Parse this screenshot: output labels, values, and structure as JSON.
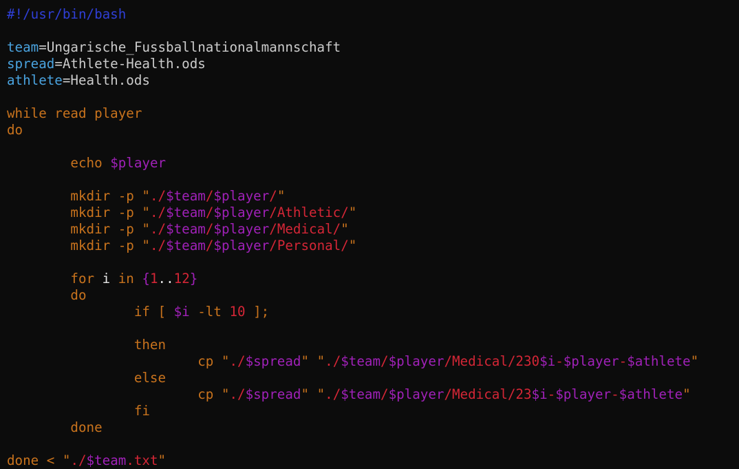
{
  "colors": {
    "background": "#0c0c0c",
    "shebang": "#2f3fd6",
    "variable_name": "#4aa3df",
    "plain_text": "#cccccc",
    "keyword": "#c9731d",
    "expansion": "#a021b8",
    "string_literal": "#d42636",
    "identifier": "#e6e6e6"
  },
  "editor": {
    "cursor": {
      "line": 24,
      "after_token": 12
    },
    "lines": [
      [
        {
          "t": "#!/usr/bin/bash",
          "c": "shebang"
        }
      ],
      [],
      [
        {
          "t": "team",
          "c": "var"
        },
        {
          "t": "=Ungarische_Fussballnationalmannschaft",
          "c": "plain"
        }
      ],
      [
        {
          "t": "spread",
          "c": "var"
        },
        {
          "t": "=Athlete-Health.ods",
          "c": "plain"
        }
      ],
      [
        {
          "t": "athlete",
          "c": "var"
        },
        {
          "t": "=Health.ods",
          "c": "plain"
        }
      ],
      [],
      [
        {
          "t": "while read player",
          "c": "kw"
        }
      ],
      [
        {
          "t": "do",
          "c": "kw"
        }
      ],
      [],
      [
        {
          "t": "        echo ",
          "c": "kw"
        },
        {
          "t": "$player",
          "c": "purple"
        }
      ],
      [],
      [
        {
          "t": "        mkdir -p ",
          "c": "kw"
        },
        {
          "t": "\"",
          "c": "kw"
        },
        {
          "t": "./",
          "c": "red"
        },
        {
          "t": "$team",
          "c": "purple"
        },
        {
          "t": "/",
          "c": "red"
        },
        {
          "t": "$player",
          "c": "purple"
        },
        {
          "t": "/",
          "c": "red"
        },
        {
          "t": "\"",
          "c": "kw"
        }
      ],
      [
        {
          "t": "        mkdir -p ",
          "c": "kw"
        },
        {
          "t": "\"",
          "c": "kw"
        },
        {
          "t": "./",
          "c": "red"
        },
        {
          "t": "$team",
          "c": "purple"
        },
        {
          "t": "/",
          "c": "red"
        },
        {
          "t": "$player",
          "c": "purple"
        },
        {
          "t": "/Athletic/",
          "c": "red"
        },
        {
          "t": "\"",
          "c": "kw"
        }
      ],
      [
        {
          "t": "        mkdir -p ",
          "c": "kw"
        },
        {
          "t": "\"",
          "c": "kw"
        },
        {
          "t": "./",
          "c": "red"
        },
        {
          "t": "$team",
          "c": "purple"
        },
        {
          "t": "/",
          "c": "red"
        },
        {
          "t": "$player",
          "c": "purple"
        },
        {
          "t": "/Medical/",
          "c": "red"
        },
        {
          "t": "\"",
          "c": "kw"
        }
      ],
      [
        {
          "t": "        mkdir -p ",
          "c": "kw"
        },
        {
          "t": "\"",
          "c": "kw"
        },
        {
          "t": "./",
          "c": "red"
        },
        {
          "t": "$team",
          "c": "purple"
        },
        {
          "t": "/",
          "c": "red"
        },
        {
          "t": "$player",
          "c": "purple"
        },
        {
          "t": "/Personal/",
          "c": "red"
        },
        {
          "t": "\"",
          "c": "kw"
        }
      ],
      [],
      [
        {
          "t": "        for ",
          "c": "kw"
        },
        {
          "t": "i",
          "c": "white"
        },
        {
          "t": " in ",
          "c": "kw"
        },
        {
          "t": "{",
          "c": "purple"
        },
        {
          "t": "1",
          "c": "red"
        },
        {
          "t": "..",
          "c": "white"
        },
        {
          "t": "12",
          "c": "red"
        },
        {
          "t": "}",
          "c": "purple"
        }
      ],
      [
        {
          "t": "        do",
          "c": "kw"
        }
      ],
      [
        {
          "t": "                if [ ",
          "c": "kw"
        },
        {
          "t": "$i",
          "c": "purple"
        },
        {
          "t": " -lt ",
          "c": "kw"
        },
        {
          "t": "10",
          "c": "red"
        },
        {
          "t": " ];",
          "c": "kw"
        }
      ],
      [],
      [
        {
          "t": "                then",
          "c": "kw"
        }
      ],
      [
        {
          "t": "                        cp ",
          "c": "kw"
        },
        {
          "t": "\"",
          "c": "kw"
        },
        {
          "t": "./",
          "c": "red"
        },
        {
          "t": "$spread",
          "c": "purple"
        },
        {
          "t": "\"",
          "c": "kw"
        },
        {
          "t": " ",
          "c": "kw"
        },
        {
          "t": "\"",
          "c": "kw"
        },
        {
          "t": "./",
          "c": "red"
        },
        {
          "t": "$team",
          "c": "purple"
        },
        {
          "t": "/",
          "c": "red"
        },
        {
          "t": "$player",
          "c": "purple"
        },
        {
          "t": "/Medical/230",
          "c": "red"
        },
        {
          "t": "$i",
          "c": "purple"
        },
        {
          "t": "-",
          "c": "red"
        },
        {
          "t": "$player",
          "c": "purple"
        },
        {
          "t": "-",
          "c": "red"
        },
        {
          "t": "$athlete",
          "c": "purple"
        },
        {
          "t": "\"",
          "c": "kw"
        }
      ],
      [
        {
          "t": "                else",
          "c": "kw"
        }
      ],
      [
        {
          "t": "                        cp ",
          "c": "kw"
        },
        {
          "t": "\"",
          "c": "kw"
        },
        {
          "t": "./",
          "c": "red"
        },
        {
          "t": "$spread",
          "c": "purple"
        },
        {
          "t": "\"",
          "c": "kw"
        },
        {
          "t": " ",
          "c": "kw"
        },
        {
          "t": "\"",
          "c": "kw"
        },
        {
          "t": "./",
          "c": "red"
        },
        {
          "t": "$team",
          "c": "purple"
        },
        {
          "t": "/",
          "c": "red"
        },
        {
          "t": "$player",
          "c": "purple"
        },
        {
          "t": "/Medical/23",
          "c": "red"
        },
        {
          "t": "$i",
          "c": "purple"
        },
        {
          "t": "-",
          "c": "red"
        },
        {
          "t": "$player",
          "c": "purple"
        },
        {
          "t": "-",
          "c": "red"
        },
        {
          "t": "$athlet",
          "c": "purple"
        },
        {
          "t": "e",
          "c": "purple"
        },
        {
          "t": "\"",
          "c": "kw"
        }
      ],
      [
        {
          "t": "                fi",
          "c": "kw"
        }
      ],
      [
        {
          "t": "        done",
          "c": "kw"
        }
      ],
      [],
      [
        {
          "t": "done < ",
          "c": "kw"
        },
        {
          "t": "\"",
          "c": "kw"
        },
        {
          "t": "./",
          "c": "red"
        },
        {
          "t": "$team",
          "c": "purple"
        },
        {
          "t": ".txt",
          "c": "red"
        },
        {
          "t": "\"",
          "c": "kw"
        }
      ]
    ]
  }
}
